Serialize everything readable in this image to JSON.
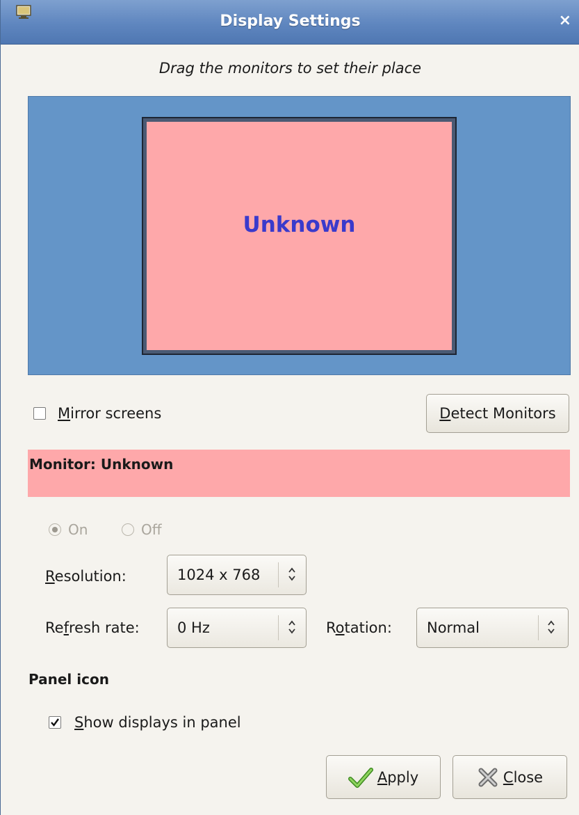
{
  "window": {
    "title": "Display Settings",
    "close_glyph": "×"
  },
  "arena": {
    "hint": "Drag the monitors to set their place",
    "monitor_label": "Unknown"
  },
  "mirror": {
    "mnemonic": "M",
    "rest": "irror screens",
    "checked": false
  },
  "detect_button": {
    "mnemonic": "D",
    "rest": "etect Monitors"
  },
  "monitor_header": {
    "text": "Monitor: Unknown",
    "color": "#fea8aa"
  },
  "power": {
    "on_label": "On",
    "off_label": "Off",
    "selected": "On"
  },
  "resolution": {
    "label_mnemonic": "R",
    "label_rest": "esolution:",
    "value": "1024 x 768"
  },
  "refresh": {
    "label_pre": "Re",
    "label_mnemonic": "f",
    "label_post": "resh rate:",
    "value": "0 Hz"
  },
  "rotation": {
    "label_pre": "R",
    "label_mnemonic": "o",
    "label_post": "tation:",
    "value": "Normal"
  },
  "panel_icon": {
    "heading": "Panel icon",
    "checkbox_mnemonic": "S",
    "checkbox_rest": "how displays in panel",
    "checked": true
  },
  "buttons": {
    "apply_mnemonic": "A",
    "apply_rest": "pply",
    "close_mnemonic": "C",
    "close_rest": "lose"
  },
  "colors": {
    "titlebar": "#5f86bf",
    "arena_bg": "#6495c8",
    "monitor_fill": "#fea8aa",
    "monitor_label": "#3a3acb"
  }
}
